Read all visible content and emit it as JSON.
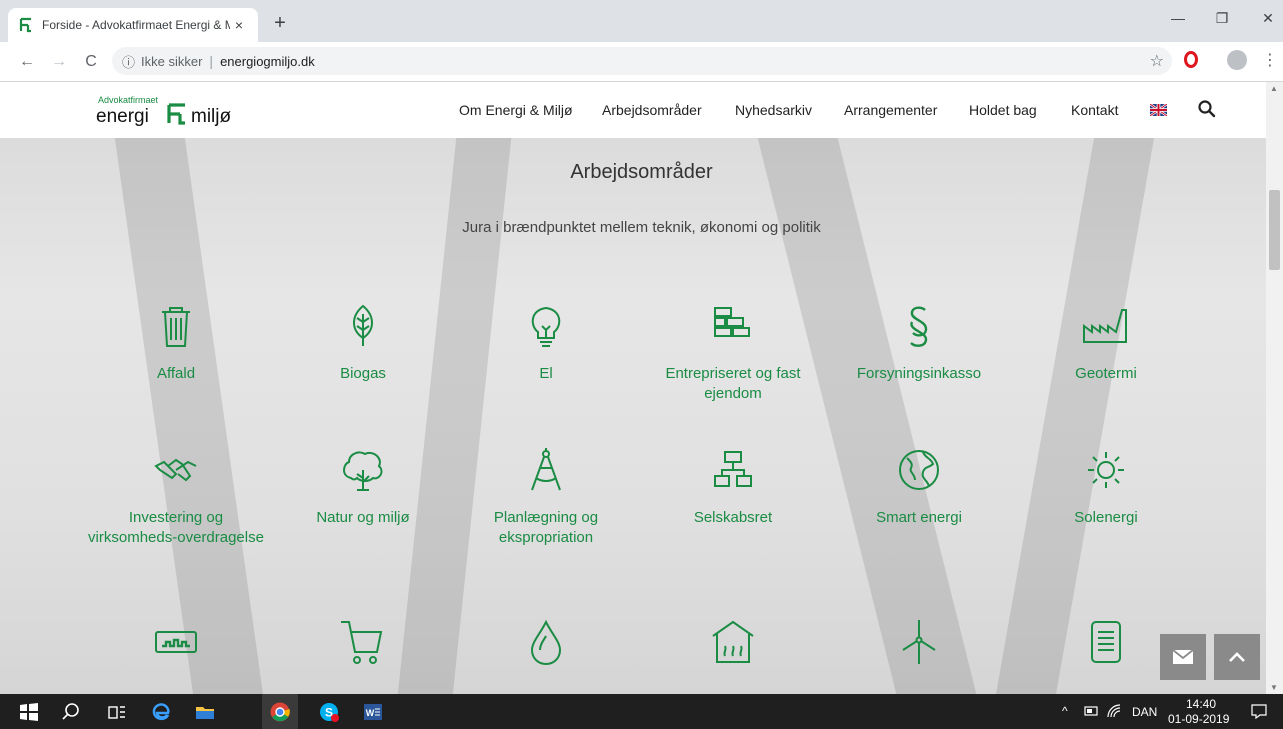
{
  "browser": {
    "tab_title": "Forside - Advokatfirmaet Energi & Miljø",
    "tab_close": "×",
    "new_tab": "+",
    "win_min": "—",
    "win_restore": "❐",
    "win_close": "✕",
    "back": "←",
    "forward": "→",
    "reload": "C",
    "info": "ⓘ",
    "security": "Ikke sikker",
    "separator": "|",
    "url": "energiogmiljo.dk",
    "star": "☆",
    "menu": "⋮"
  },
  "site": {
    "logo_small": "Advokatfirmaet",
    "logo_left": "energi",
    "logo_right": "miljø",
    "nav": [
      {
        "label": "Om Energi & Miljø"
      },
      {
        "label": "Arbejdsområder"
      },
      {
        "label": "Nyhedsarkiv"
      },
      {
        "label": "Arrangementer"
      },
      {
        "label": "Holdet bag"
      },
      {
        "label": "Kontakt"
      }
    ],
    "section_title": "Arbejdsområder",
    "section_subtitle": "Jura i brændpunktet mellem teknik, økonomi og politik",
    "areas": [
      {
        "label": "Affald",
        "icon": "trash-icon"
      },
      {
        "label": "Biogas",
        "icon": "leaf-icon"
      },
      {
        "label": "El",
        "icon": "lightbulb-icon"
      },
      {
        "label": "Entrepriseret og fast ejendom",
        "icon": "bricks-icon"
      },
      {
        "label": "Forsyningsinkasso",
        "icon": "paragraph-icon"
      },
      {
        "label": "Geotermi",
        "icon": "factory-icon"
      },
      {
        "label": "Investering og virksomheds-overdragelse",
        "icon": "handshake-icon"
      },
      {
        "label": "Natur og miljø",
        "icon": "tree-icon"
      },
      {
        "label": "Planlægning og ekspropriation",
        "icon": "compass-icon"
      },
      {
        "label": "Selskabsret",
        "icon": "org-chart-icon"
      },
      {
        "label": "Smart energi",
        "icon": "globe-icon"
      },
      {
        "label": "Solenergi",
        "icon": "sun-icon"
      },
      {
        "label": "",
        "icon": "meter-icon"
      },
      {
        "label": "",
        "icon": "cart-icon"
      },
      {
        "label": "",
        "icon": "drop-icon"
      },
      {
        "label": "",
        "icon": "heating-house-icon"
      },
      {
        "label": "",
        "icon": "wind-turbine-icon"
      },
      {
        "label": "",
        "icon": "document-icon"
      }
    ]
  },
  "taskbar": {
    "lang": "DAN",
    "time": "14:40",
    "date": "01-09-2019"
  },
  "colors": {
    "brand_green": "#1a8c44",
    "taskbar": "#1f1f1f"
  }
}
